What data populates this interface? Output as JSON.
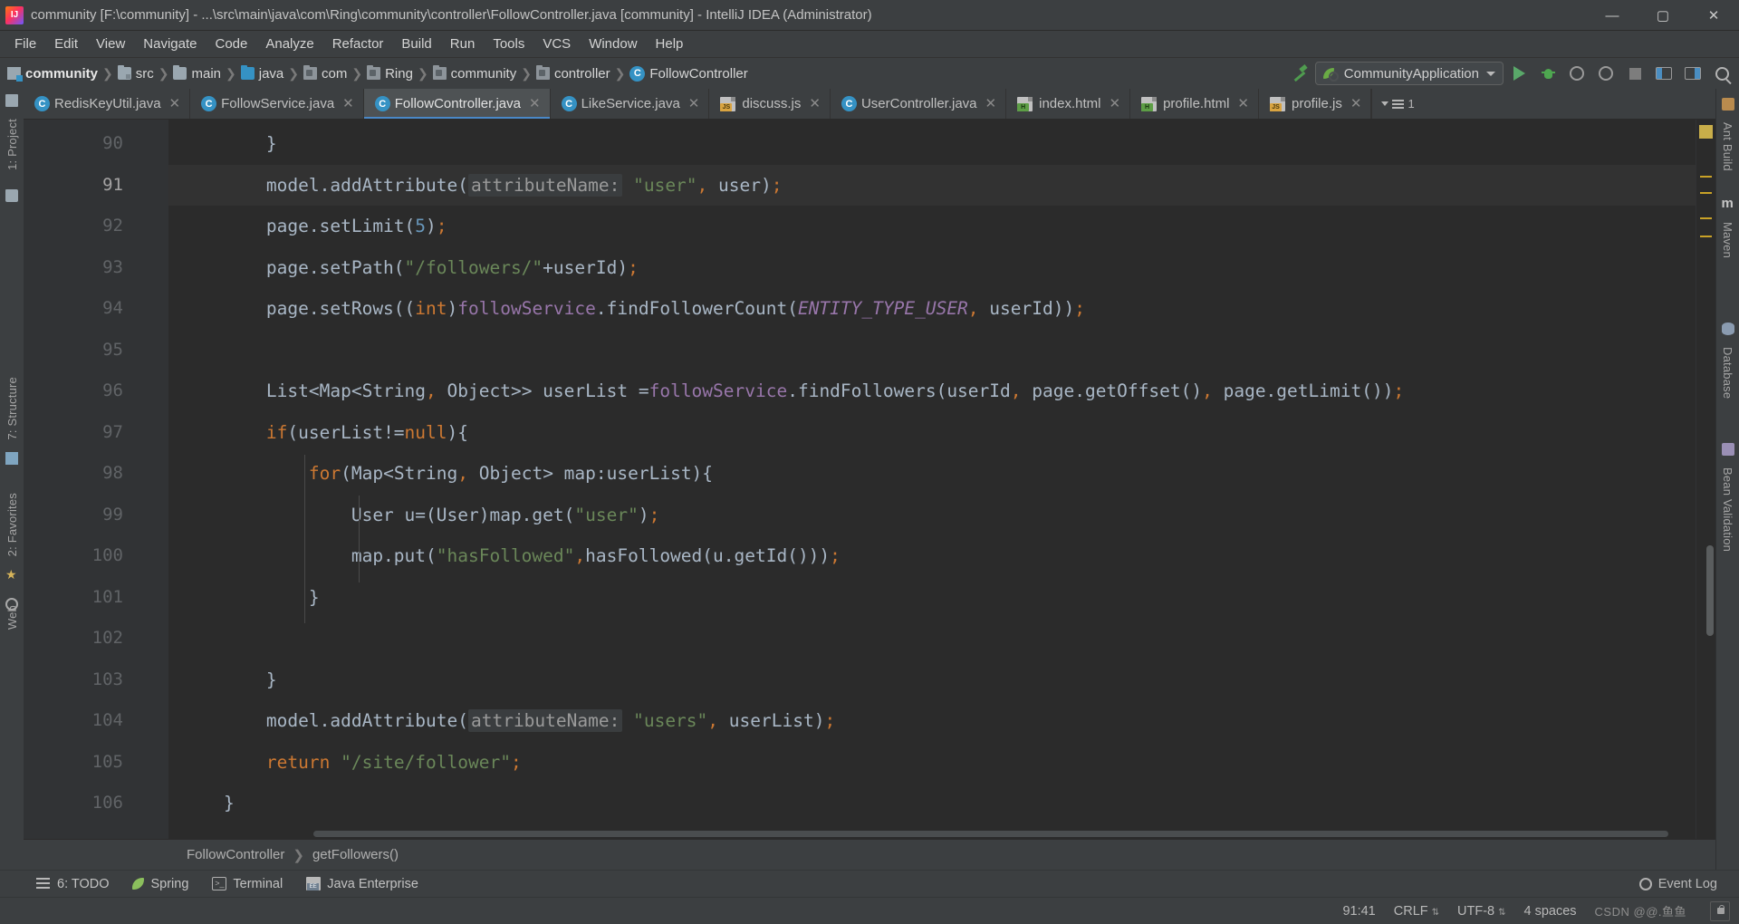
{
  "window": {
    "title": "community [F:\\community] - ...\\src\\main\\java\\com\\Ring\\community\\controller\\FollowController.java [community] - IntelliJ IDEA (Administrator)",
    "minimize": "—",
    "maximize": "▢",
    "close": "✕"
  },
  "menu": {
    "items": [
      "File",
      "Edit",
      "View",
      "Navigate",
      "Code",
      "Analyze",
      "Refactor",
      "Build",
      "Run",
      "Tools",
      "VCS",
      "Window",
      "Help"
    ]
  },
  "navbar": {
    "crumbs": [
      {
        "label": "community",
        "icon": "module-icon",
        "bold": true
      },
      {
        "label": "src",
        "icon": "folder-src-icon",
        "bold": false
      },
      {
        "label": "main",
        "icon": "folder-icon",
        "bold": false
      },
      {
        "label": "java",
        "icon": "folder-java-icon",
        "bold": false
      },
      {
        "label": "com",
        "icon": "package-icon",
        "bold": false
      },
      {
        "label": "Ring",
        "icon": "package-icon",
        "bold": false
      },
      {
        "label": "community",
        "icon": "package-icon",
        "bold": false
      },
      {
        "label": "controller",
        "icon": "package-icon",
        "bold": false
      },
      {
        "label": "FollowController",
        "icon": "class-icon",
        "bold": false
      }
    ],
    "separator": "❯",
    "run_config": "CommunityApplication",
    "class_glyph": "C",
    "toolbar_icons": [
      "build-hammer-icon",
      "run-icon",
      "debug-icon",
      "run-coverage-icon",
      "profile-icon",
      "stop-icon",
      "layout-left-icon",
      "layout-right-icon",
      "search-everywhere-icon"
    ]
  },
  "tabs": {
    "items": [
      {
        "label": "RedisKeyUtil.java",
        "icon": "java-class-icon",
        "active": false
      },
      {
        "label": "FollowService.java",
        "icon": "java-class-icon",
        "active": false
      },
      {
        "label": "FollowController.java",
        "icon": "java-class-icon",
        "active": true
      },
      {
        "label": "LikeService.java",
        "icon": "java-class-icon",
        "active": false
      },
      {
        "label": "discuss.js",
        "icon": "js-file-icon",
        "active": false
      },
      {
        "label": "UserController.java",
        "icon": "java-class-icon",
        "active": false
      },
      {
        "label": "index.html",
        "icon": "html-file-icon",
        "active": false
      },
      {
        "label": "profile.html",
        "icon": "html-file-icon",
        "active": false
      },
      {
        "label": "profile.js",
        "icon": "js-file-icon",
        "active": false
      }
    ],
    "close_glyph": "✕",
    "overflow_count": "1"
  },
  "editor": {
    "line_numbers": [
      "90",
      "91",
      "92",
      "93",
      "94",
      "95",
      "96",
      "97",
      "98",
      "99",
      "100",
      "101",
      "102",
      "103",
      "104",
      "105",
      "106"
    ],
    "current_line": "91",
    "lines": [
      {
        "n": "90",
        "text": "        }"
      },
      {
        "n": "91",
        "text": "        model.addAttribute( attributeName: \"user\", user);"
      },
      {
        "n": "92",
        "text": "        page.setLimit(5);"
      },
      {
        "n": "93",
        "text": "        page.setPath(\"/followers/\"+userId);"
      },
      {
        "n": "94",
        "text": "        page.setRows((int)followService.findFollowerCount(ENTITY_TYPE_USER, userId));"
      },
      {
        "n": "95",
        "text": ""
      },
      {
        "n": "96",
        "text": "        List<Map<String, Object>> userList =followService.findFollowers(userId, page.getOffset(), page.getLimit());"
      },
      {
        "n": "97",
        "text": "        if(userList!=null){"
      },
      {
        "n": "98",
        "text": "            for(Map<String, Object> map:userList){"
      },
      {
        "n": "99",
        "text": "                User u=(User)map.get(\"user\");"
      },
      {
        "n": "100",
        "text": "                map.put(\"hasFollowed\",hasFollowed(u.getId()));"
      },
      {
        "n": "101",
        "text": "            }"
      },
      {
        "n": "102",
        "text": ""
      },
      {
        "n": "103",
        "text": "        }"
      },
      {
        "n": "104",
        "text": "        model.addAttribute( attributeName: \"users\", userList);"
      },
      {
        "n": "105",
        "text": "        return \"/site/follower\";"
      },
      {
        "n": "106",
        "text": "    }"
      }
    ],
    "breadcrumb": {
      "class": "FollowController",
      "method": "getFollowers()",
      "separator": "❯"
    }
  },
  "left_sidebar": {
    "items": [
      {
        "label": "1: Project",
        "icon": "project-icon"
      },
      {
        "label": "7: Structure",
        "icon": "structure-icon"
      },
      {
        "label": "2: Favorites",
        "icon": "favorites-star-icon"
      },
      {
        "label": "Web",
        "icon": "web-globe-icon"
      }
    ]
  },
  "right_sidebar": {
    "items": [
      {
        "label": "Ant Build",
        "icon": "ant-icon"
      },
      {
        "label": "Maven",
        "icon": "maven-icon"
      },
      {
        "label": "Database",
        "icon": "database-icon"
      },
      {
        "label": "Bean Validation",
        "icon": "bean-validation-icon"
      }
    ]
  },
  "toolwindow_bar": {
    "items": [
      {
        "label": "6: TODO",
        "icon": "todo-list-icon",
        "mnemonic": "6"
      },
      {
        "label": "Spring",
        "icon": "spring-leaf-icon"
      },
      {
        "label": "Terminal",
        "icon": "terminal-icon"
      },
      {
        "label": "Java Enterprise",
        "icon": "java-enterprise-icon"
      }
    ]
  },
  "statusbar": {
    "caret": "91:41",
    "line_separator": "CRLF",
    "encoding": "UTF-8",
    "indent": "4 spaces",
    "event_log": "Event Log",
    "watermark": "CSDN @@.鱼鱼",
    "lock_icon": "read-only-lock-icon"
  },
  "colors": {
    "accent": "#4a88c7",
    "editor_bg": "#2b2b2b",
    "chrome_bg": "#3c3f41",
    "gutter_bg": "#313335",
    "keyword": "#cc7832",
    "string": "#6a8759",
    "number": "#6897bb",
    "field": "#9876aa",
    "default_text": "#a9b7c6",
    "run_green": "#59a869"
  }
}
